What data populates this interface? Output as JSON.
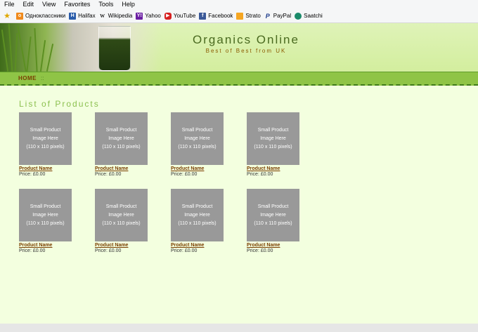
{
  "menu": [
    "File",
    "Edit",
    "View",
    "Favorites",
    "Tools",
    "Help"
  ],
  "favorites": [
    {
      "label": "Одноклассники",
      "icon": "odnoklassniki-icon",
      "color": "#f08a1d"
    },
    {
      "label": "Halifax",
      "icon": "halifax-icon",
      "color": "#2a5caa"
    },
    {
      "label": "Wikipedia",
      "icon": "wikipedia-icon",
      "color": "#555555"
    },
    {
      "label": "Yahoo",
      "icon": "yahoo-icon",
      "color": "#6b1fa3"
    },
    {
      "label": "YouTube",
      "icon": "youtube-icon",
      "color": "#d62020"
    },
    {
      "label": "Facebook",
      "icon": "facebook-icon",
      "color": "#3b5998"
    },
    {
      "label": "Strato",
      "icon": "strato-icon",
      "color": "#f5a623"
    },
    {
      "label": "PayPal",
      "icon": "paypal-icon",
      "color": "#1e3c8c"
    },
    {
      "label": "Saatchi",
      "icon": "saatchi-icon",
      "color": "#1a8a6a"
    }
  ],
  "header": {
    "title": "Organics Online",
    "tagline": "Best of Best from UK"
  },
  "nav": {
    "home": "HOME",
    "separator": "::"
  },
  "main": {
    "section_title": "List of Products",
    "products": [
      {
        "image_text": [
          "Small Product",
          "Image Here",
          "(110 x 110 pixels)"
        ],
        "name": "Product Name",
        "price": "Price: £0.00"
      },
      {
        "image_text": [
          "Small Product",
          "Image Here",
          "(110 x 110 pixels)"
        ],
        "name": "Product Name",
        "price": "Price: £0.00"
      },
      {
        "image_text": [
          "Small Product",
          "Image Here",
          "(110 x 110 pixels)"
        ],
        "name": "Product Name",
        "price": "Price: £0.00"
      },
      {
        "image_text": [
          "Small Product",
          "Image Here",
          "(110 x 110 pixels)"
        ],
        "name": "Product Name",
        "price": "Price: £0.00"
      },
      {
        "image_text": [
          "Small Product",
          "Image Here",
          "(110 x 110 pixels)"
        ],
        "name": "Product Name",
        "price": "Price: £0.00"
      },
      {
        "image_text": [
          "Small Product",
          "Image Here",
          "(110 x 110 pixels)"
        ],
        "name": "Product Name",
        "price": "Price: £0.00"
      },
      {
        "image_text": [
          "Small Product",
          "Image Here",
          "(110 x 110 pixels)"
        ],
        "name": "Product Name",
        "price": "Price: £0.00"
      },
      {
        "image_text": [
          "Small Product",
          "Image Here",
          "(110 x 110 pixels)"
        ],
        "name": "Product Name",
        "price": "Price: £0.00"
      }
    ]
  },
  "colors": {
    "page_bg": "#f3ffdf",
    "header_bg": "#d7efac",
    "nav_bg": "#8fc446",
    "accent_brown": "#7a3e00",
    "title_green": "#4a6a20",
    "section_green": "#8cc050",
    "placeholder_gray": "#999999"
  }
}
